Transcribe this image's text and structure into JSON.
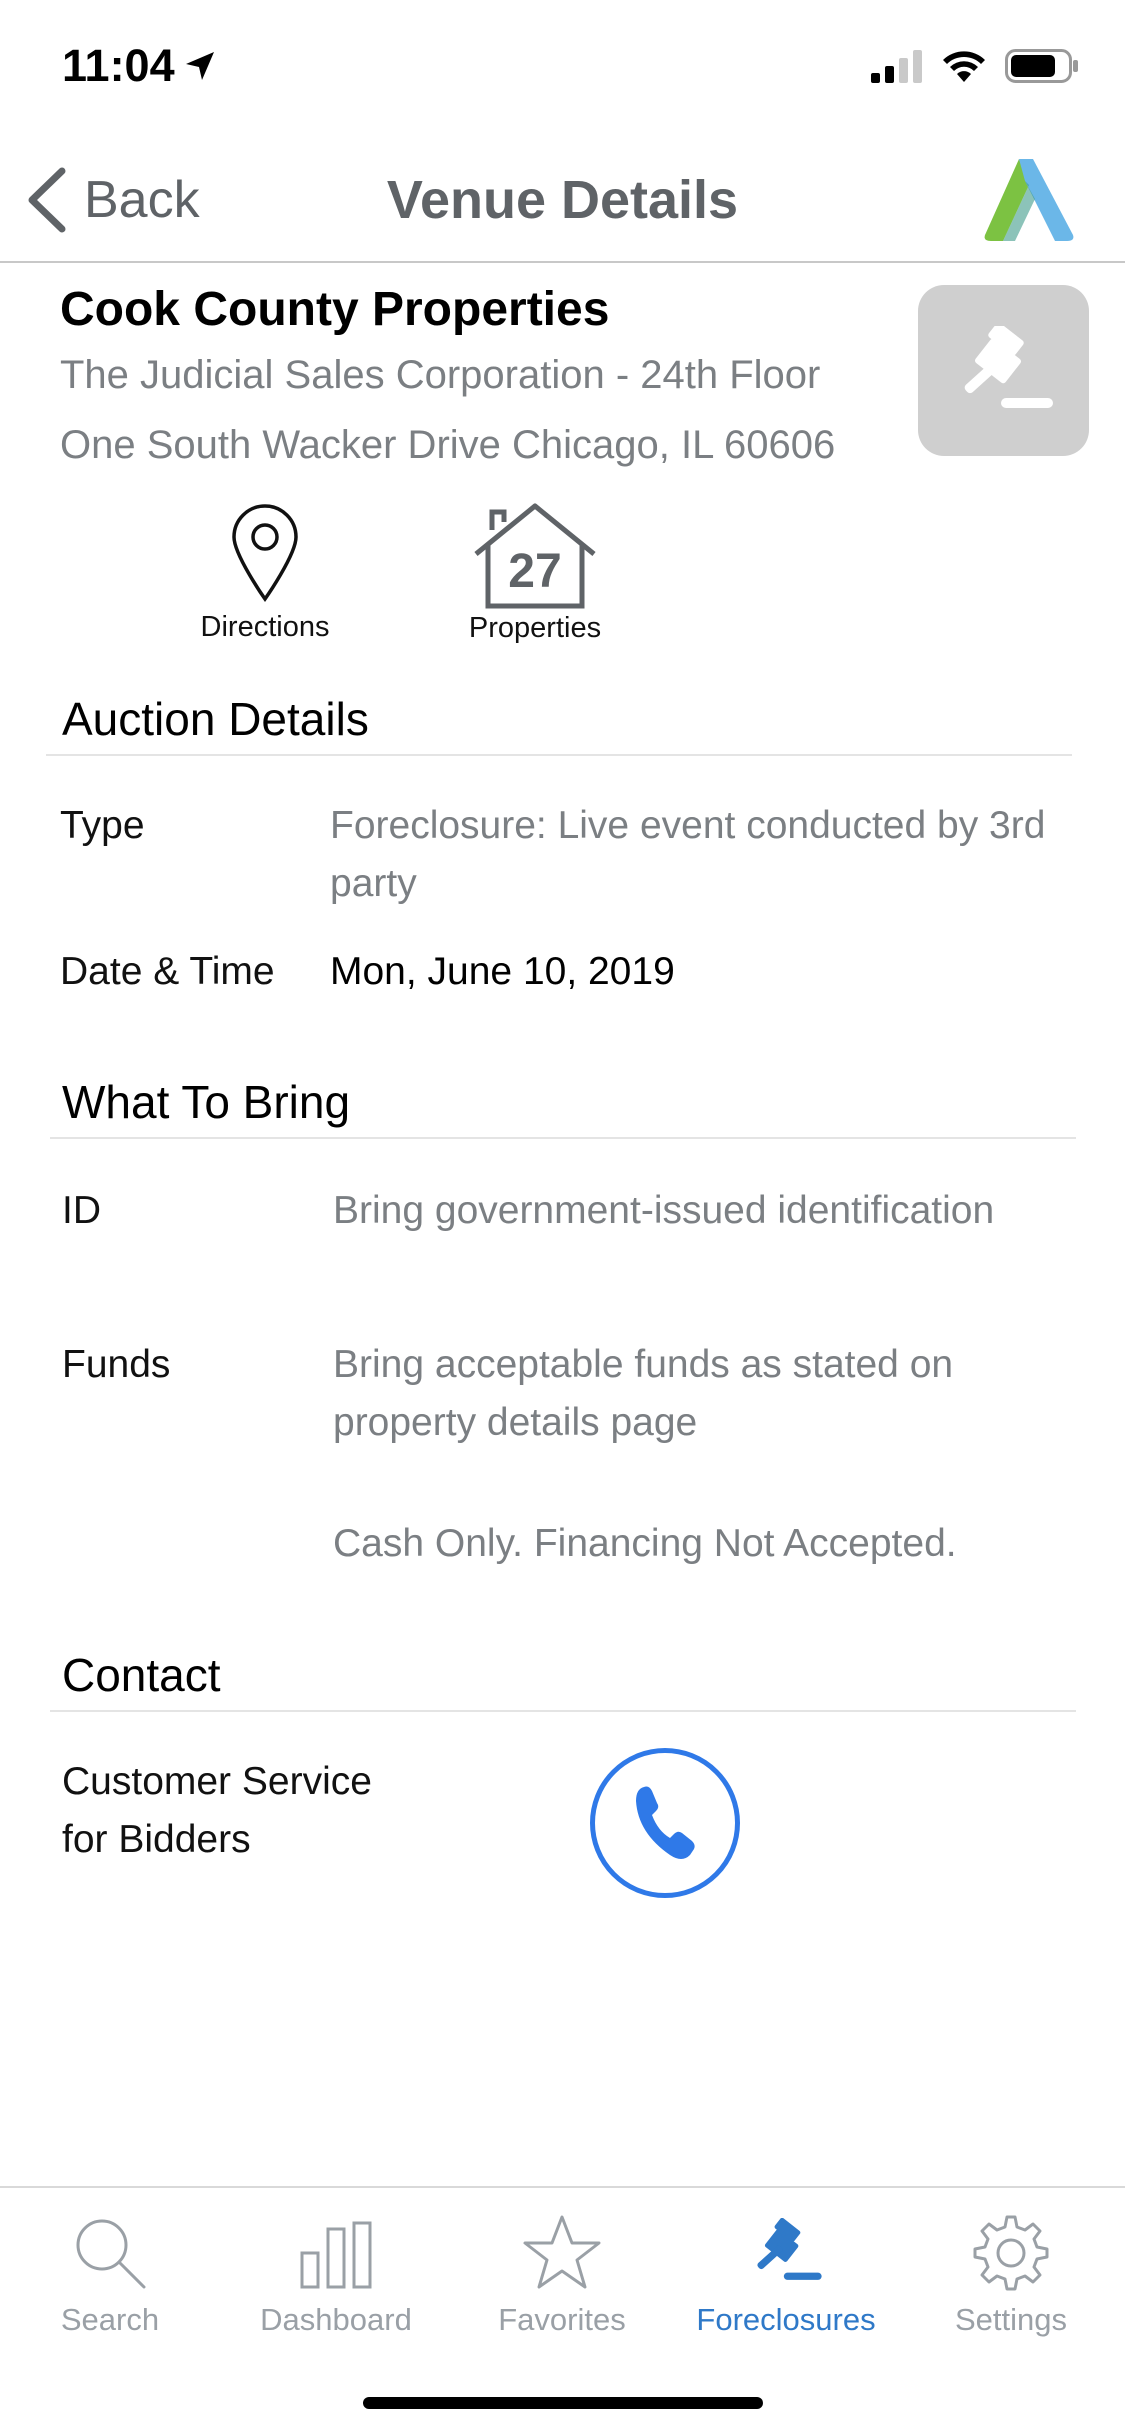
{
  "status_bar": {
    "time": "11:04"
  },
  "nav": {
    "back_label": "Back",
    "title": "Venue Details"
  },
  "venue": {
    "name": "Cook County Properties",
    "line1": "The Judicial Sales Corporation - 24th Floor",
    "line2": "One South Wacker Drive Chicago, IL 60606"
  },
  "actions": {
    "directions_label": "Directions",
    "properties_count": "27",
    "properties_label": "Properties"
  },
  "auction_details": {
    "title": "Auction Details",
    "type_label": "Type",
    "type_value": "Foreclosure: Live event conducted by 3rd party",
    "datetime_label": "Date & Time",
    "datetime_value": "Mon, June 10, 2019"
  },
  "what_to_bring": {
    "title": "What To Bring",
    "id_label": "ID",
    "id_value": "Bring government-issued identification",
    "funds_label": "Funds",
    "funds_value": "Bring acceptable funds as stated on property details page",
    "funds_note": "Cash Only. Financing Not Accepted."
  },
  "contact": {
    "title": "Contact",
    "label_line1": "Customer Service",
    "label_line2": "for Bidders"
  },
  "tabs": [
    {
      "label": "Search",
      "icon": "search-icon"
    },
    {
      "label": "Dashboard",
      "icon": "bar-chart-icon"
    },
    {
      "label": "Favorites",
      "icon": "star-icon"
    },
    {
      "label": "Foreclosures",
      "icon": "gavel-icon"
    },
    {
      "label": "Settings",
      "icon": "gear-icon"
    }
  ],
  "active_tab": "Foreclosures",
  "colors": {
    "accent": "#2f79c8",
    "phone_blue": "#2f79e8",
    "gray_text": "#7b7f83",
    "tab_gray": "#9aa0a6"
  }
}
